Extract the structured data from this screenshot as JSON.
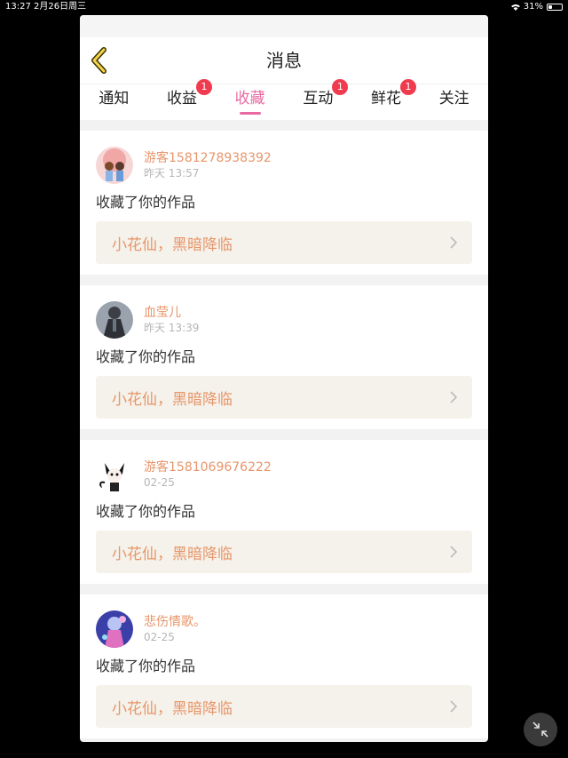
{
  "status_bar": {
    "time": "13:27",
    "date": "2月26日周三",
    "battery": "31%",
    "battery_level": 0.31
  },
  "header": {
    "title": "消息"
  },
  "tabs": [
    {
      "label": "通知",
      "badge": ""
    },
    {
      "label": "收益",
      "badge": "1"
    },
    {
      "label": "收藏",
      "badge": "",
      "active": true
    },
    {
      "label": "互动",
      "badge": "1"
    },
    {
      "label": "鲜花",
      "badge": "1"
    },
    {
      "label": "关注",
      "badge": ""
    }
  ],
  "messages": [
    {
      "user": "游客1581278938392",
      "time": "昨天 13:57",
      "action": "收藏了你的作品",
      "work": "小花仙，黑暗降临",
      "avatar_icon": "couple-avatar-icon"
    },
    {
      "user": "血莹儿",
      "time": "昨天 13:39",
      "action": "收藏了你的作品",
      "work": "小花仙，黑暗降临",
      "avatar_icon": "dark-character-avatar-icon"
    },
    {
      "user": "游客1581069676222",
      "time": "02-25",
      "action": "收藏了你的作品",
      "work": "小花仙，黑暗降临",
      "avatar_icon": "cat-avatar-icon"
    },
    {
      "user": "悲伤情歌。",
      "time": "02-25",
      "action": "收藏了你的作品",
      "work": "小花仙，黑暗降临",
      "avatar_icon": "anime-girl-avatar-icon"
    }
  ],
  "colors": {
    "accent": "#e86aa3",
    "name": "#e8956a",
    "badge": "#f03b4f"
  }
}
